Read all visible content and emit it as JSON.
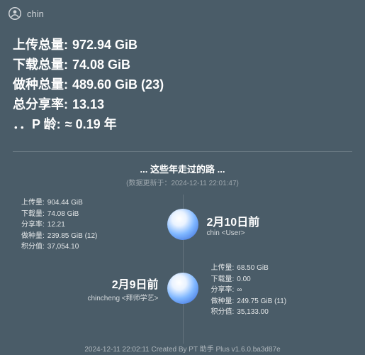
{
  "header": {
    "username": "chin"
  },
  "stats": {
    "upload_label": "上传总量:",
    "upload_value": "972.94 GiB",
    "download_label": "下载总量:",
    "download_value": "74.08 GiB",
    "seed_label": "做种总量:",
    "seed_value": "489.60 GiB (23)",
    "ratio_label": "总分享率:",
    "ratio_value": "13.13",
    "age_label": "．．P 龄:",
    "age_value": "≈ 0.19 年"
  },
  "timeline": {
    "title": "... 这些年走过的路 ...",
    "subtitle": "(数据更新于：2024-12-11 22:01:47)"
  },
  "detail_labels": {
    "upload": "上传量:",
    "download": "下载量:",
    "ratio": "分享率:",
    "seed": "做种量:",
    "points": "积分值:"
  },
  "snap1": {
    "date": "2月10日前",
    "user": "chin  <User>",
    "upload": "904.44 GiB",
    "download": "74.08 GiB",
    "ratio": "12.21",
    "seed": "239.85 GiB (12)",
    "points": "37,054.10"
  },
  "snap2": {
    "date": "2月9日前",
    "user": "chincheng  <拜师学艺>",
    "upload": "68.50 GiB",
    "download": "0.00",
    "ratio": "∞",
    "seed": "249.75 GiB (11)",
    "points": "35,133.00"
  },
  "footer": {
    "text": "2024-12-11 22:02:11 Created By PT 助手 Plus v1.6.0.ba3d87e"
  }
}
